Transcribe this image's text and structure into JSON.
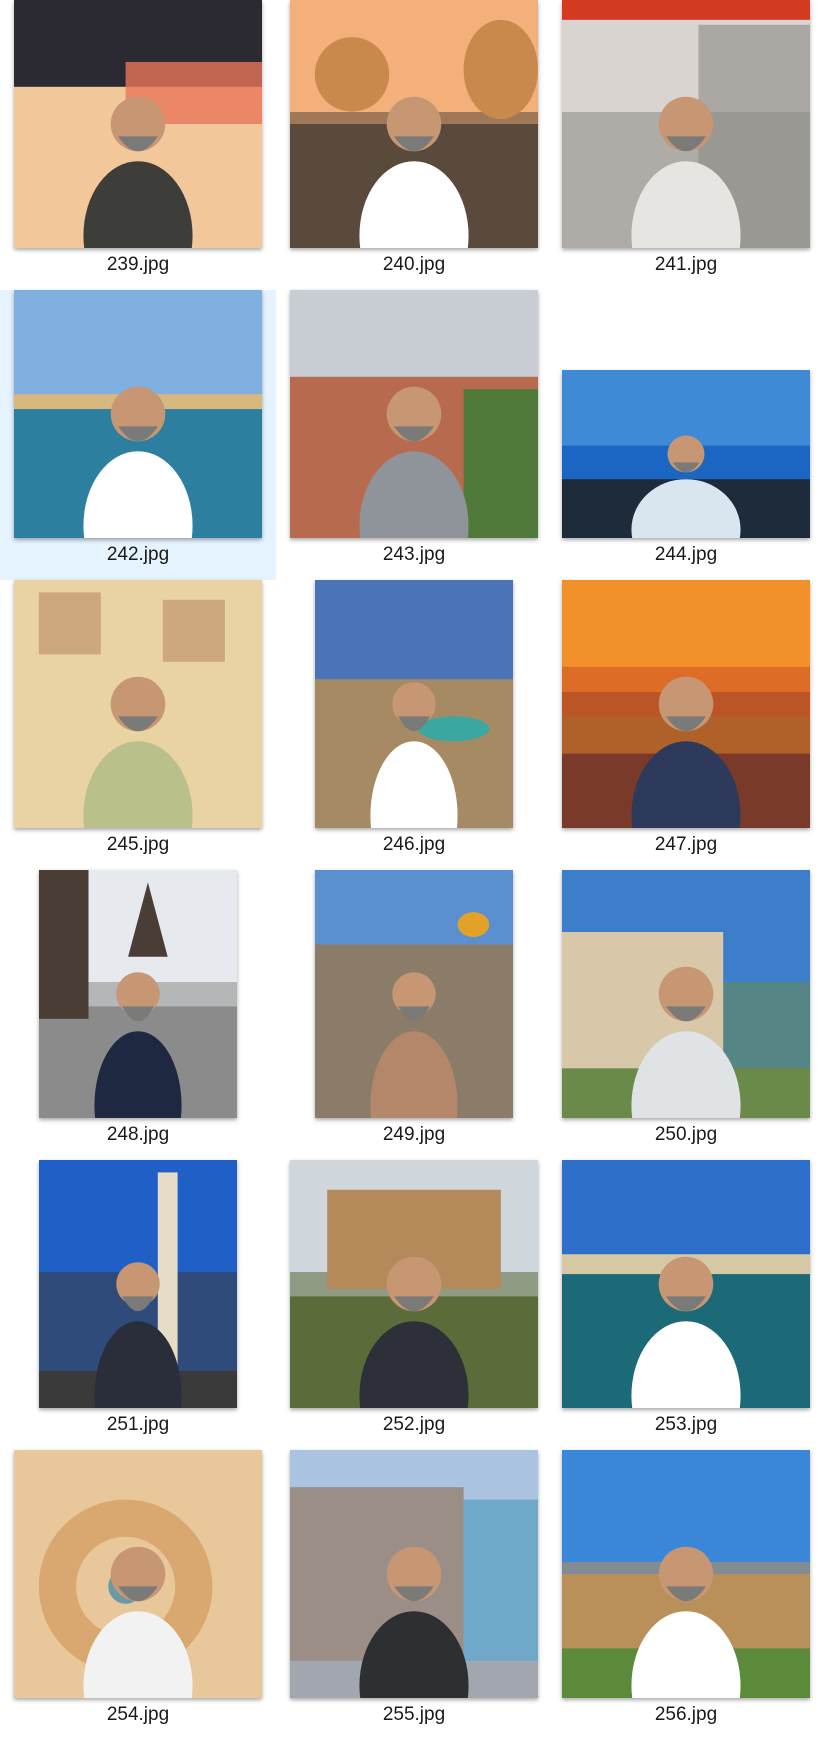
{
  "files": [
    {
      "name": "239.jpg",
      "scene": "rooftop-night",
      "orientation": "landscape",
      "selected": false,
      "palette": {
        "sky": "#2b2a33",
        "ground": "#f2c79a",
        "accent": "#e8755a",
        "person": "#3d3d3a"
      }
    },
    {
      "name": "240.jpg",
      "scene": "sea-rocks",
      "orientation": "landscape",
      "selected": false,
      "palette": {
        "sky": "#f3b07a",
        "ground": "#5a4a3c",
        "accent": "#c9894c",
        "person": "#ffffff"
      }
    },
    {
      "name": "241.jpg",
      "scene": "bridge-selfie",
      "orientation": "landscape",
      "selected": false,
      "palette": {
        "sky": "#d9d4cf",
        "ground": "#8c8a86",
        "accent": "#d33a1f",
        "person": "#e7e5e2"
      }
    },
    {
      "name": "242.jpg",
      "scene": "harbor-balcony",
      "orientation": "landscape",
      "selected": true,
      "palette": {
        "sky": "#7fb0e0",
        "ground": "#2d7fa0",
        "accent": "#d8b87f",
        "person": "#ffffff"
      }
    },
    {
      "name": "243.jpg",
      "scene": "city-hill",
      "orientation": "landscape",
      "selected": false,
      "palette": {
        "sky": "#c7cdd3",
        "ground": "#b86a4e",
        "accent": "#4f7a3a",
        "person": "#8f949a"
      }
    },
    {
      "name": "244.jpg",
      "scene": "ocean-lounge",
      "orientation": "wide",
      "selected": false,
      "palette": {
        "sky": "#3f8ad6",
        "ground": "#1e2b3a",
        "accent": "#1a66c2",
        "person": "#d9e6ef"
      }
    },
    {
      "name": "245.jpg",
      "scene": "ceiling-selfie",
      "orientation": "landscape",
      "selected": false,
      "palette": {
        "sky": "#e9d3a3",
        "ground": "#c9a86a",
        "accent": "#9a5a3a",
        "person": "#b9c08a"
      }
    },
    {
      "name": "246.jpg",
      "scene": "cafe-terrace",
      "orientation": "portrait",
      "selected": false,
      "palette": {
        "sky": "#4a74b7",
        "ground": "#a58a63",
        "accent": "#3aa8a0",
        "person": "#ffffff"
      }
    },
    {
      "name": "247.jpg",
      "scene": "sunset-wall",
      "orientation": "landscape",
      "selected": false,
      "palette": {
        "sky": "#f2902a",
        "ground": "#7a3a2a",
        "accent": "#c74a22",
        "person": "#2e3a5c"
      }
    },
    {
      "name": "248.jpg",
      "scene": "old-square",
      "orientation": "portrait",
      "selected": false,
      "palette": {
        "sky": "#e6eaef",
        "ground": "#8b8b8b",
        "accent": "#4a3d36",
        "person": "#1e2840"
      }
    },
    {
      "name": "249.jpg",
      "scene": "beach-selfie",
      "orientation": "portrait",
      "selected": false,
      "palette": {
        "sky": "#5c8fd0",
        "ground": "#8a7c68",
        "accent": "#e2a22a",
        "person": "#b5876a"
      }
    },
    {
      "name": "250.jpg",
      "scene": "coast-town",
      "orientation": "landscape",
      "selected": false,
      "palette": {
        "sky": "#3d7ecb",
        "ground": "#6a8a4a",
        "accent": "#d8c7a8",
        "person": "#dfe3e6"
      }
    },
    {
      "name": "251.jpg",
      "scene": "column-monument",
      "orientation": "portrait",
      "selected": false,
      "palette": {
        "sky": "#1f5fc6",
        "ground": "#3a3a3a",
        "accent": "#e7ddc6",
        "person": "#2a2e3a"
      }
    },
    {
      "name": "252.jpg",
      "scene": "palace-pool",
      "orientation": "landscape",
      "selected": false,
      "palette": {
        "sky": "#cfd6dc",
        "ground": "#5b6b3a",
        "accent": "#b48a5a",
        "person": "#2d3038"
      }
    },
    {
      "name": "253.jpg",
      "scene": "marina-selfie",
      "orientation": "landscape",
      "selected": false,
      "palette": {
        "sky": "#2d6fca",
        "ground": "#1c6a78",
        "accent": "#d6c8a4",
        "person": "#ffffff"
      }
    },
    {
      "name": "254.jpg",
      "scene": "spiral-stair",
      "orientation": "landscape",
      "selected": false,
      "palette": {
        "sky": "#c98a45",
        "ground": "#e8c79a",
        "accent": "#7a4e2a",
        "person": "#f2f2f2"
      }
    },
    {
      "name": "255.jpg",
      "scene": "dancing-house",
      "orientation": "landscape",
      "selected": false,
      "palette": {
        "sky": "#a9c3e0",
        "ground": "#9a8e86",
        "accent": "#6fa8c9",
        "person": "#2e2f33"
      }
    },
    {
      "name": "256.jpg",
      "scene": "city-overlook",
      "orientation": "landscape",
      "selected": false,
      "palette": {
        "sky": "#3a86d8",
        "ground": "#b98f5a",
        "accent": "#5b8a3a",
        "person": "#ffffff"
      }
    }
  ]
}
